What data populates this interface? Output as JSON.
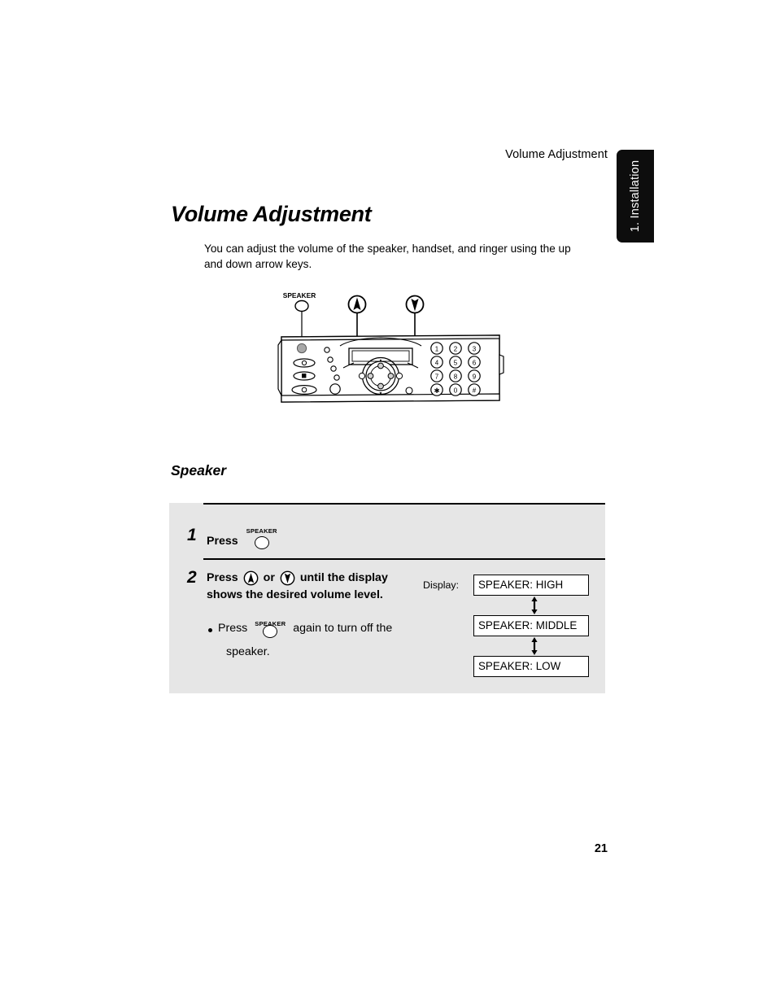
{
  "header": {
    "running_title": "Volume Adjustment",
    "side_tab": "1. Installation"
  },
  "title": "Volume Adjustment",
  "intro": "You can adjust the volume of the speaker, handset, and ringer using the up and down arrow keys.",
  "figure": {
    "callouts": {
      "speaker_label": "SPEAKER",
      "up_arrow": "up-arrow-key",
      "down_arrow": "down-arrow-key"
    },
    "keypad": [
      "1",
      "2",
      "3",
      "4",
      "5",
      "6",
      "7",
      "8",
      "9",
      "∗",
      "0",
      "#"
    ]
  },
  "section": {
    "heading": "Speaker",
    "steps": [
      {
        "number": "1",
        "text_before": "Press",
        "key_label": "SPEAKER"
      },
      {
        "number": "2",
        "line1_a": "Press",
        "line1_or": "or",
        "line1_b": "until the display",
        "line2": "shows the desired volume level.",
        "bullet_a": "Press",
        "bullet_key": "SPEAKER",
        "bullet_b": "again to turn off the",
        "bullet_c": "speaker."
      }
    ],
    "display_flow": {
      "label": "Display:",
      "items": [
        "SPEAKER: HIGH",
        "SPEAKER: MIDDLE",
        "SPEAKER: LOW"
      ]
    }
  },
  "page_number": "21",
  "colors": {
    "panel_bg": "#e6e6e6",
    "tab_bg": "#0d0d0d",
    "ink": "#000000"
  }
}
